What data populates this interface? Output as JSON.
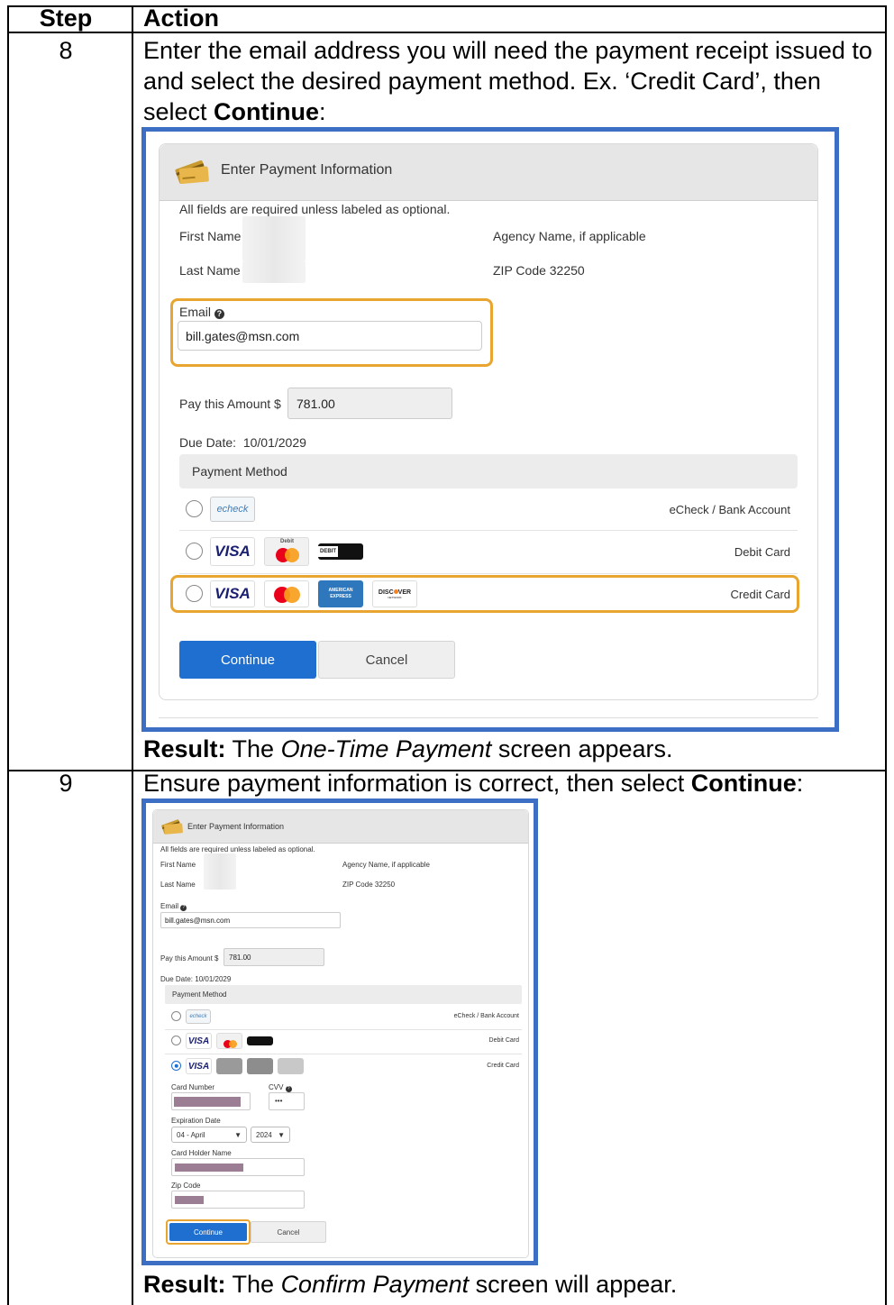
{
  "table": {
    "headers": {
      "step": "Step",
      "action": "Action"
    },
    "row8": {
      "step": "8",
      "instruction_part1": "Enter the email address you will need the payment receipt issued to and select the desired payment method. Ex. ‘Credit Card’, then select ",
      "instruction_bold": "Continue",
      "instruction_end": ":",
      "result_label": "Result:",
      "result_pre": " The ",
      "result_italic": "One-Time Payment",
      "result_post": " screen appears."
    },
    "row9": {
      "step": "9",
      "instruction_part1": "Ensure payment information is correct, then select ",
      "instruction_bold": "Continue",
      "instruction_end": ":",
      "result_label": "Result:",
      "result_pre": " The ",
      "result_italic": "Confirm Payment",
      "result_post": " screen will appear."
    }
  },
  "form": {
    "title": "Enter Payment Information",
    "required_note": "All fields are required unless labeled as optional.",
    "first_name_label": "First Name",
    "last_name_label": "Last Name",
    "agency_label": "Agency Name, if applicable",
    "zip_text": "ZIP Code 32250",
    "email_label": "Email",
    "email_help_icon": "question-circle-icon",
    "email_value": "bill.gates@msn.com",
    "amount_label": "Pay this Amount $",
    "amount_value": "781.00",
    "due_date_label": "Due Date:",
    "due_date_value": "10/01/2029",
    "payment_method_header": "Payment Method",
    "methods": {
      "echeck": "eCheck / Bank Account",
      "debit": "Debit Card",
      "credit": "Credit Card"
    },
    "card_logos": {
      "echeck": "echeck",
      "visa": "VISA",
      "mastercard": "MasterCard",
      "debit_tag": "Debit",
      "amex_line1": "AMERICAN",
      "amex_line2": "EXPRESS",
      "discover_pre": "DISC",
      "discover_post": "VER",
      "discover_debit": "DEBIT",
      "discover_network": "NETWORK"
    },
    "continue_label": "Continue",
    "cancel_label": "Cancel",
    "card_number_label": "Card Number",
    "cvv_label": "CVV",
    "cvv_value": "•••",
    "expiration_label": "Expiration Date",
    "exp_month": "04 - April",
    "exp_year": "2024",
    "card_holder_label": "Card Holder Name",
    "zip_code_label": "Zip Code"
  },
  "colors": {
    "screenshot_border": "#3c6fc4",
    "highlight": "#e8a530",
    "primary_button": "#1f6fd1",
    "redaction": "#9b7e93"
  }
}
